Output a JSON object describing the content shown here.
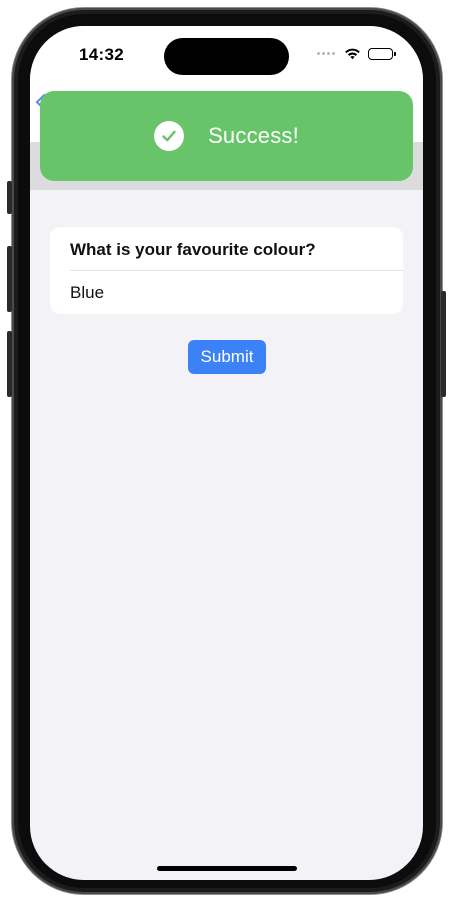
{
  "status_bar": {
    "time": "14:32"
  },
  "toast": {
    "message": "Success!",
    "icon": "checkmark-circle-icon",
    "color": "#67c468"
  },
  "form": {
    "question": "What is your favourite colour?",
    "answer_value": "Blue",
    "submit_label": "Submit"
  },
  "colors": {
    "accent": "#3a82f6",
    "background": "#f2f2f7",
    "success": "#67c468"
  }
}
